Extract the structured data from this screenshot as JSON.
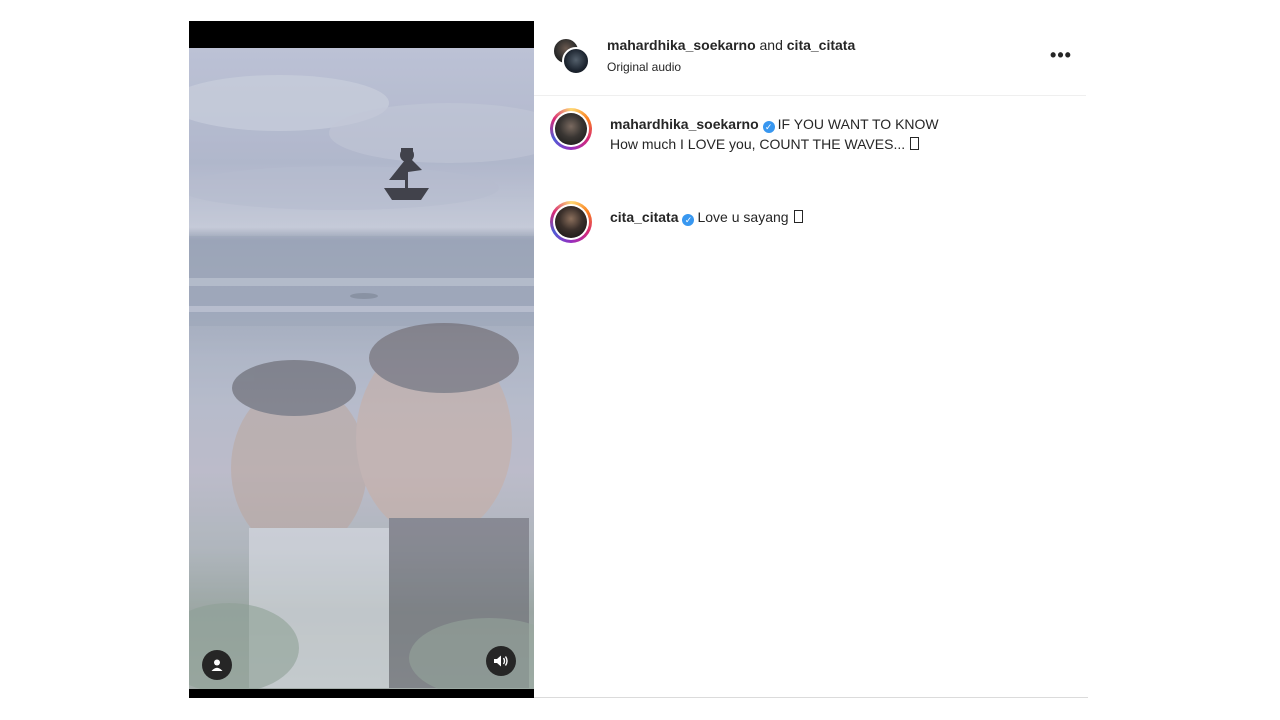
{
  "post": {
    "header": {
      "author_primary": "mahardhika_soekarno",
      "joiner": "and",
      "author_secondary": "cita_citata",
      "audio_label": "Original audio",
      "more_label": "•••"
    },
    "comments": [
      {
        "username": "mahardhika_soekarno",
        "verified": true,
        "line1": "IF YOU WANT TO KNOW",
        "line2": "How much I LOVE you, COUNT THE WAVES..."
      },
      {
        "username": "cita_citata",
        "verified": true,
        "line1": "Love u sayang"
      }
    ]
  },
  "reel": {
    "controls": {
      "tag_icon": "person-tag-icon",
      "sound_icon": "speaker-icon"
    }
  },
  "colors": {
    "verified": "#3897f0",
    "story_ring": [
      "#feda75",
      "#fa7e1e",
      "#d62976",
      "#962fbf",
      "#4f5bd5"
    ]
  }
}
